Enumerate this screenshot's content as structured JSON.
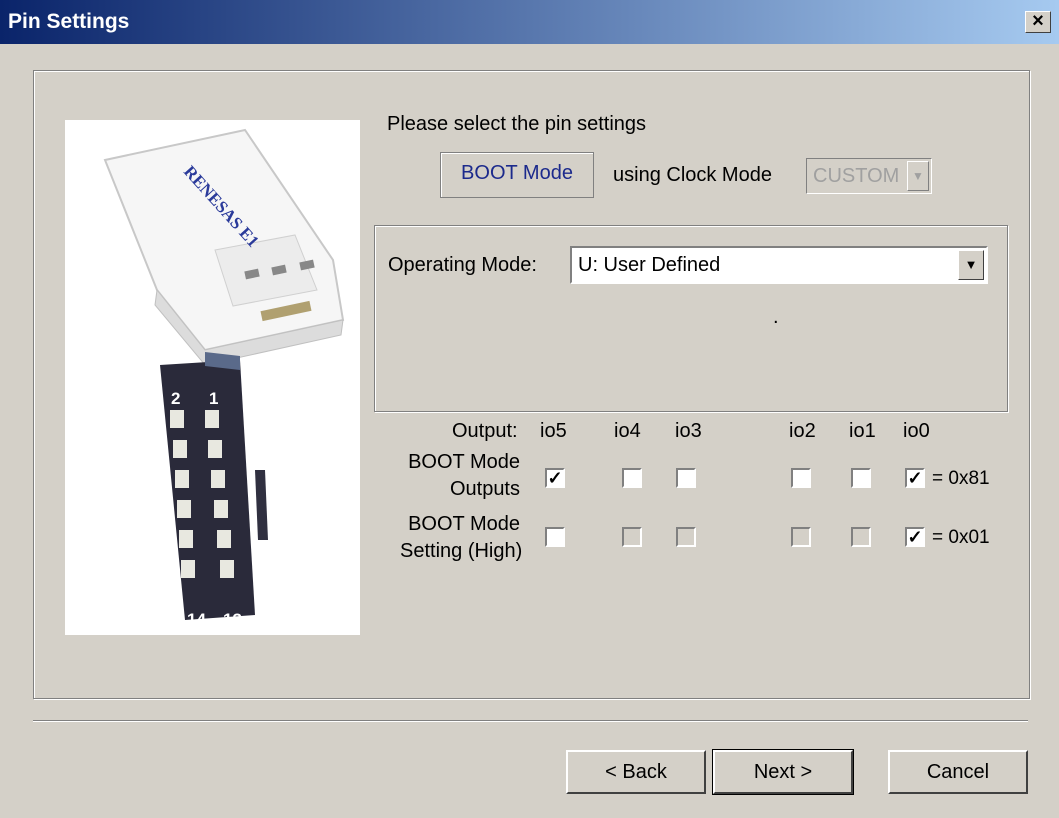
{
  "window": {
    "title": "Pin Settings",
    "close_label": "×"
  },
  "instructions": "Please select the pin settings",
  "boot_mode_label": "BOOT Mode",
  "clock_mode": {
    "label": "using Clock Mode",
    "value": "CUSTOM"
  },
  "operating_mode": {
    "label": "Operating Mode:",
    "value": "U: User Defined",
    "note": "."
  },
  "image": {
    "brand_text": "RENESAS E1",
    "pin_labels": [
      "2",
      "1",
      "14",
      "13"
    ]
  },
  "pins": {
    "output_label": "Output:",
    "columns": [
      "io5",
      "io4",
      "io3",
      "io2",
      "io1",
      "io0"
    ],
    "rows": [
      {
        "label_line1": "BOOT Mode",
        "label_line2": "Outputs",
        "checked": [
          true,
          false,
          false,
          false,
          false,
          true
        ],
        "disabled": [
          false,
          false,
          false,
          false,
          false,
          false
        ],
        "value": "= 0x81"
      },
      {
        "label_line1": "BOOT Mode",
        "label_line2": "Setting (High)",
        "checked": [
          false,
          false,
          false,
          false,
          false,
          true
        ],
        "disabled": [
          false,
          true,
          true,
          true,
          true,
          false
        ],
        "value": "= 0x01"
      }
    ]
  },
  "buttons": {
    "back": "< Back",
    "next": "Next >",
    "cancel": "Cancel"
  }
}
